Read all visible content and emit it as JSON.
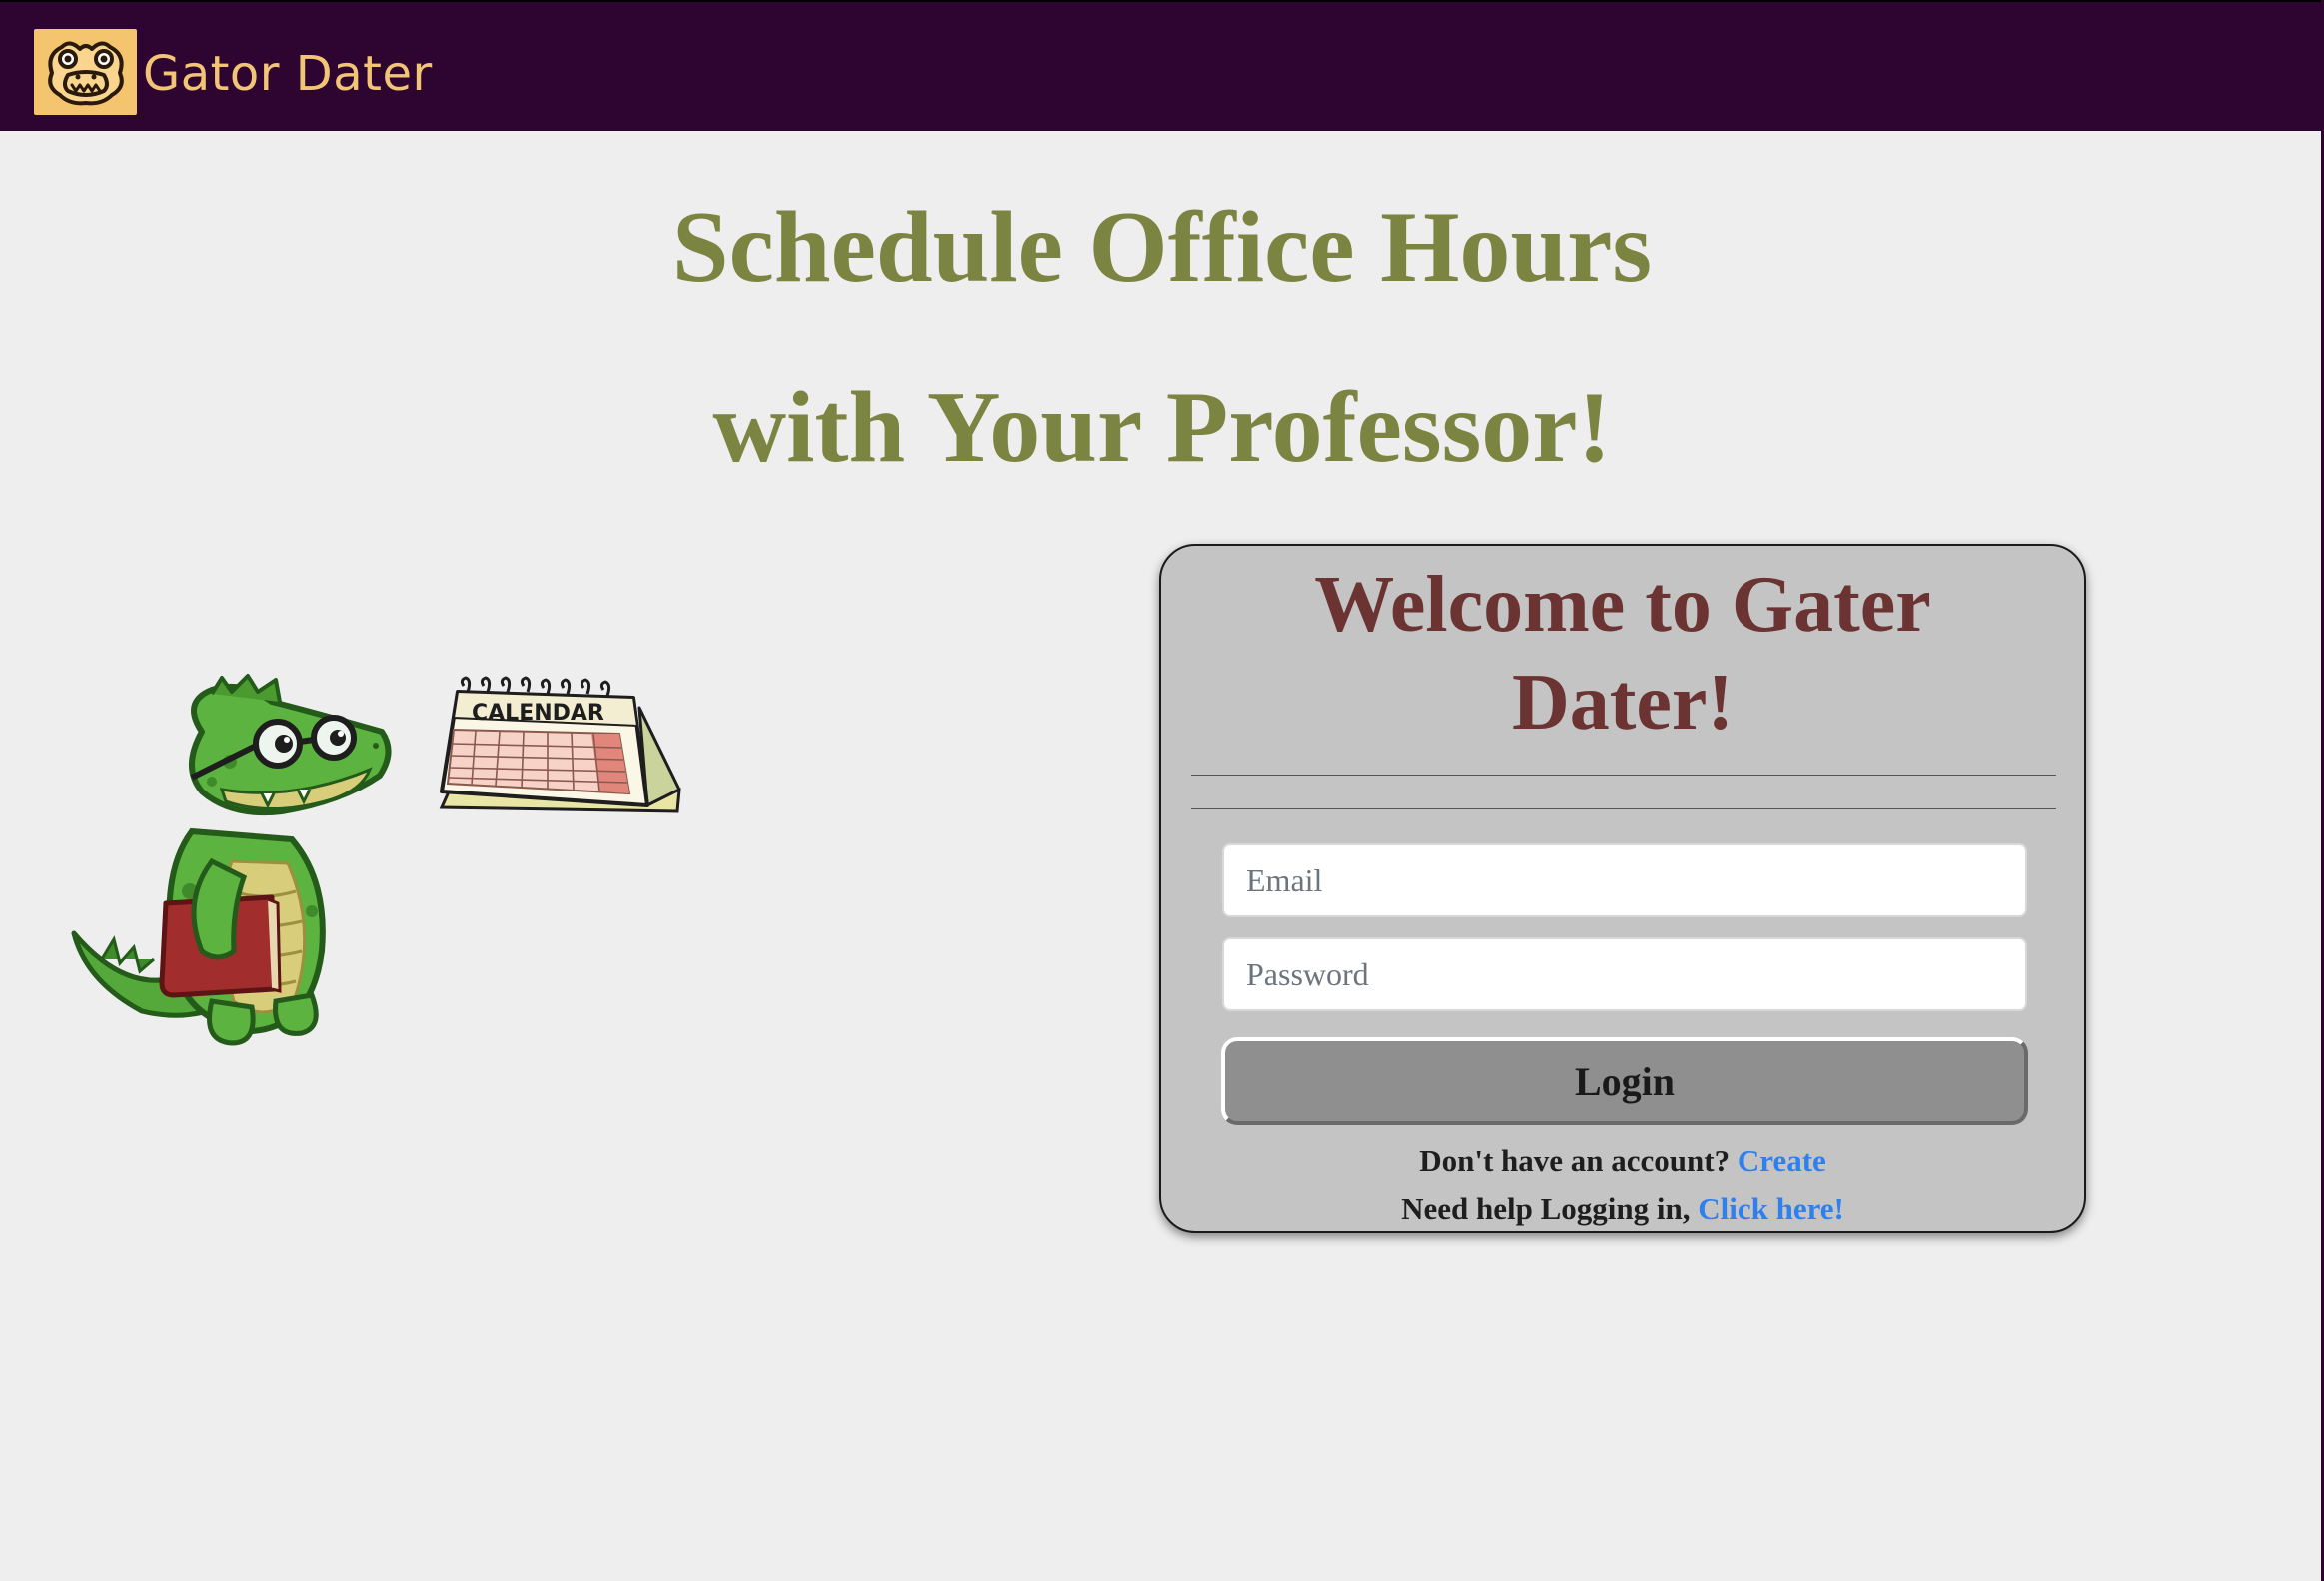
{
  "navbar": {
    "brand_name": "Gator Dater",
    "logo_icon": "gator-logo-icon",
    "bg_color": "#2e0530",
    "brand_color": "#f2c476"
  },
  "hero": {
    "line1": "Schedule Office Hours",
    "line2": "with Your Professor!",
    "color": "#7c8442"
  },
  "illustration": {
    "gator_icon": "gator-student-icon",
    "calendar_icon": "calendar-icon",
    "calendar_label": "CALENDAR"
  },
  "login_card": {
    "title_line1": "Welcome to Gater",
    "title_line2": "Dater!",
    "title_color": "#6b3332",
    "email_placeholder": "Email",
    "email_value": "",
    "password_placeholder": "Password",
    "password_value": "",
    "login_label": "Login",
    "signup_prompt": "Don't have an account?",
    "signup_link": "Create",
    "help_prompt": "Need help Logging in,",
    "help_link": "Click here!",
    "link_color": "#2f80ed"
  }
}
